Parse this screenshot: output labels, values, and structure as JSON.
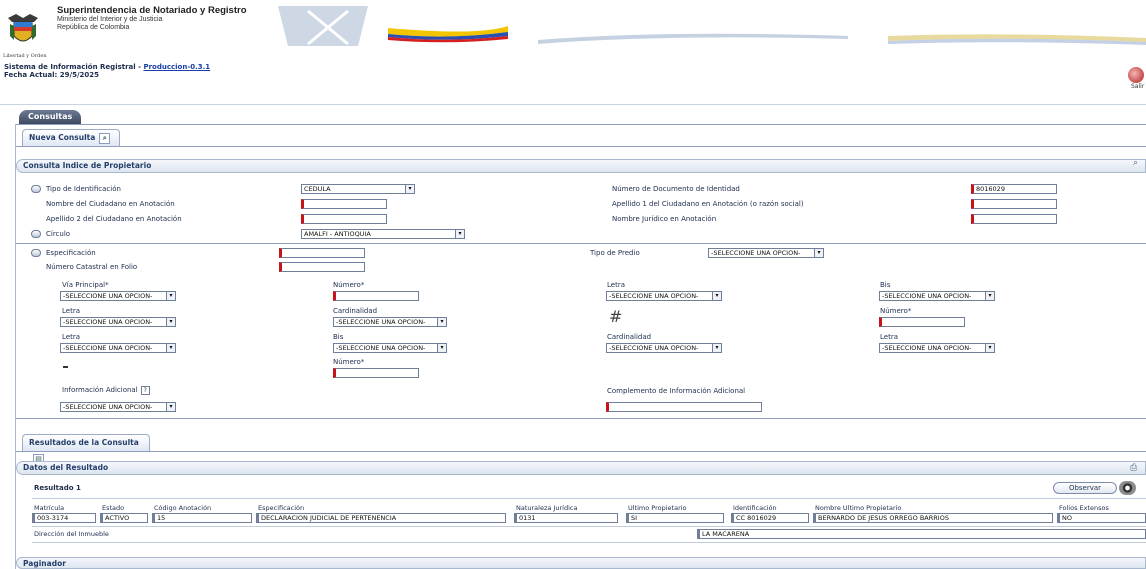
{
  "header": {
    "org_name": "Superintendencia de Notariado y Registro",
    "ministry": "Ministerio del Interior y de Justicia",
    "republic": "República de Colombia",
    "crest_caption": "Libertad y Orden",
    "system_label": "Sistema de Información Registral - ",
    "system_version": "Produccion-0.3.1",
    "date_label": "Fecha Actual: 29/5/2025",
    "exit_label": "Salir"
  },
  "tabs": {
    "consultas": "Consultas",
    "nueva": "Nueva Consulta",
    "resultados": "Resultados de la Consulta"
  },
  "section_title": "Consulta Indice de Propietario",
  "form": {
    "tipo_id_label": "Tipo de Identificación",
    "tipo_id_value": "CEDULA",
    "nombre_label": "Nombre del Ciudadano en Anotación",
    "apellido2_label": "Apellido 2 del Ciudadano en Anotación",
    "circulo_label": "Círculo",
    "circulo_value": "AMALFI - ANTIOQUIA",
    "num_doc_label": "Número de Documento de Identidad",
    "num_doc_value": "8016029",
    "apellido1_label": "Apellido 1 del Ciudadano en Anotación (o razón social)",
    "nombre_juridico_label": "Nombre Jurídico en Anotación",
    "especificacion_label": "Especificación",
    "tipo_predio_label": "Tipo de Predio",
    "numero_catastral_label": "Número Catastral en Folio",
    "select_default": "-SELECCIONE UNA OPCION-",
    "via_principal_label": "Vía Principal*",
    "numero_req_label": "Número*",
    "letra_label": "Letra",
    "bis_label": "Bis",
    "cardinalidad_label": "Cardinalidad",
    "hash_symbol": "#",
    "info_adicional_label": "Información Adicional",
    "help_symbol": "?",
    "complemento_label": "Complemento de Información Adicional"
  },
  "results": {
    "section_title": "Datos del Resultado",
    "result_label": "Resultado 1",
    "observar_label": "Observar",
    "columns": [
      "Matrícula",
      "Estado",
      "Código Anotación",
      "Especificación",
      "Naturaleza Jurídica",
      "Ultimo Propietario",
      "Identificación",
      "Nombre Ultimo Propietario",
      "Folios Extensos"
    ],
    "values": [
      "003-3174",
      "ACTIVO",
      "15",
      "DECLARACION JUDICIAL DE PERTENENCIA",
      "0131",
      "SI",
      "CC 8016029",
      "BERNARDO DE JESUS ORREGO BARRIOS",
      "NO"
    ],
    "direccion_label": "Dirección del Inmueble",
    "direccion_value": "LA MACARENA"
  },
  "paginador": "Paginador",
  "colors": {
    "required": "#c8131b",
    "tab_dark": "#3d4a61",
    "accent_link": "#1a3fa8"
  }
}
